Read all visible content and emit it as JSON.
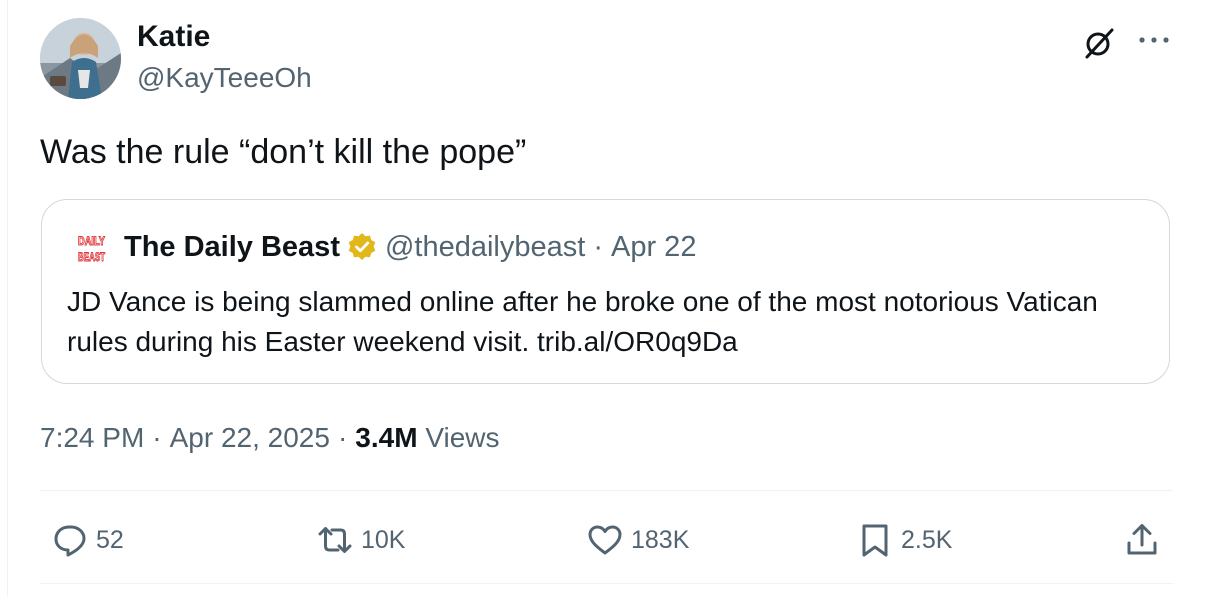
{
  "author": {
    "display_name": "Katie",
    "handle": "@KayTeeeOh",
    "avatar_icon": "profile-photo"
  },
  "tweet": {
    "text": "Was the rule “don’t kill the pope”"
  },
  "quote": {
    "logo_text": "DAILY BEAST",
    "name": "The Daily Beast",
    "handle": "@thedailybeast",
    "separator": "·",
    "date": "Apr 22",
    "text": "JD Vance is being slammed online after he broke one of the most notorious Vatican rules during his Easter weekend visit. trib.al/OR0q9Da",
    "verified_color": "#e2b719"
  },
  "meta": {
    "time": "7:24 PM",
    "date": "Apr 22, 2025",
    "separator": "·",
    "views_count": "3.4M",
    "views_label": "Views"
  },
  "actions": {
    "replies": "52",
    "reposts": "10K",
    "likes": "183K",
    "bookmarks": "2.5K"
  },
  "colors": {
    "text": "#0f1419",
    "secondary": "#536471",
    "border": "#cfd9de"
  }
}
